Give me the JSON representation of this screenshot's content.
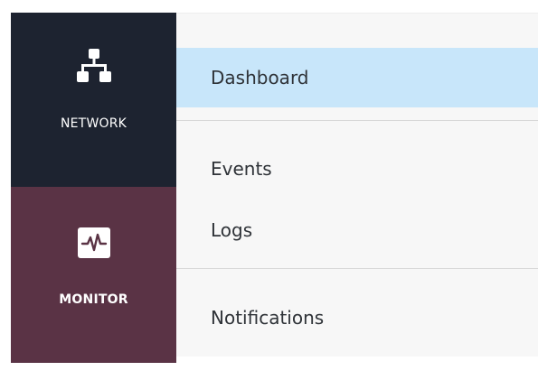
{
  "sidebar": {
    "items": [
      {
        "label": "NETWORK",
        "icon": "network-icon"
      },
      {
        "label": "MONITOR",
        "icon": "heartbeat-icon",
        "active": true
      }
    ]
  },
  "submenu": {
    "items": [
      {
        "label": "Dashboard",
        "selected": true
      },
      {
        "label": "Events"
      },
      {
        "label": "Logs"
      },
      {
        "label": "Notifications"
      }
    ]
  },
  "colors": {
    "sidebar_bg": "#1d2330",
    "active_nav_bg": "#5a3345",
    "submenu_bg": "#f7f7f7",
    "selected_item_bg": "#c8e6fa"
  }
}
